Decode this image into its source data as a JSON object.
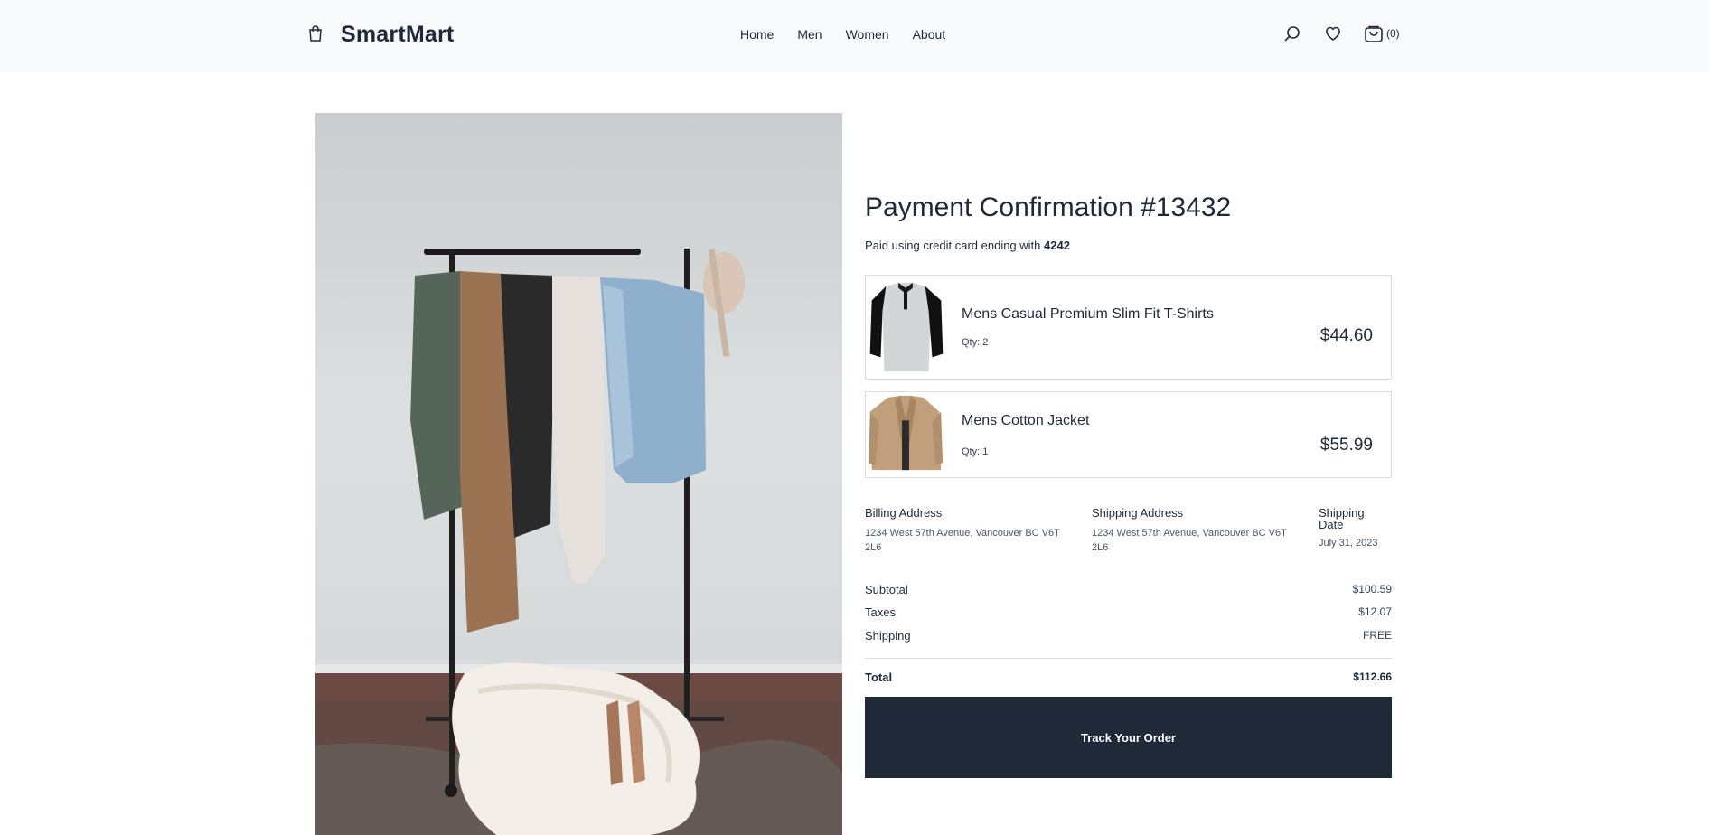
{
  "header": {
    "brand": "SmartMart",
    "nav": [
      "Home",
      "Men",
      "Women",
      "About"
    ],
    "cart_count": "(0)"
  },
  "hero": {
    "image": "clothing-rack-photo"
  },
  "confirmation": {
    "title": "Payment Confirmation #13432",
    "paid_prefix": "Paid using credit card ending with ",
    "card_last4": "4242"
  },
  "items": [
    {
      "name": "Mens Casual Premium Slim Fit T-Shirts",
      "qty": "Qty: 2",
      "price": "$44.60",
      "thumb": "henley-tshirt"
    },
    {
      "name": "Mens Cotton Jacket",
      "qty": "Qty: 1",
      "price": "$55.99",
      "thumb": "cotton-jacket"
    }
  ],
  "billing": {
    "label": "Billing Address",
    "value": "1234 West 57th Avenue, Vancouver BC V6T 2L6"
  },
  "shipping_address": {
    "label": "Shipping Address",
    "value": "1234 West 57th Avenue, Vancouver BC V6T 2L6"
  },
  "shipping_date": {
    "label": "Shipping Date",
    "value": "July 31, 2023"
  },
  "summary": {
    "subtotal_label": "Subtotal",
    "subtotal": "$100.59",
    "taxes_label": "Taxes",
    "taxes": "$12.07",
    "shipping_label": "Shipping",
    "shipping": "FREE",
    "total_label": "Total",
    "total": "$112.66"
  },
  "cta": {
    "track": "Track Your Order"
  },
  "colors": {
    "primary": "#1f2937",
    "header_bg": "#f8f9fb",
    "border": "#d9dde2"
  }
}
